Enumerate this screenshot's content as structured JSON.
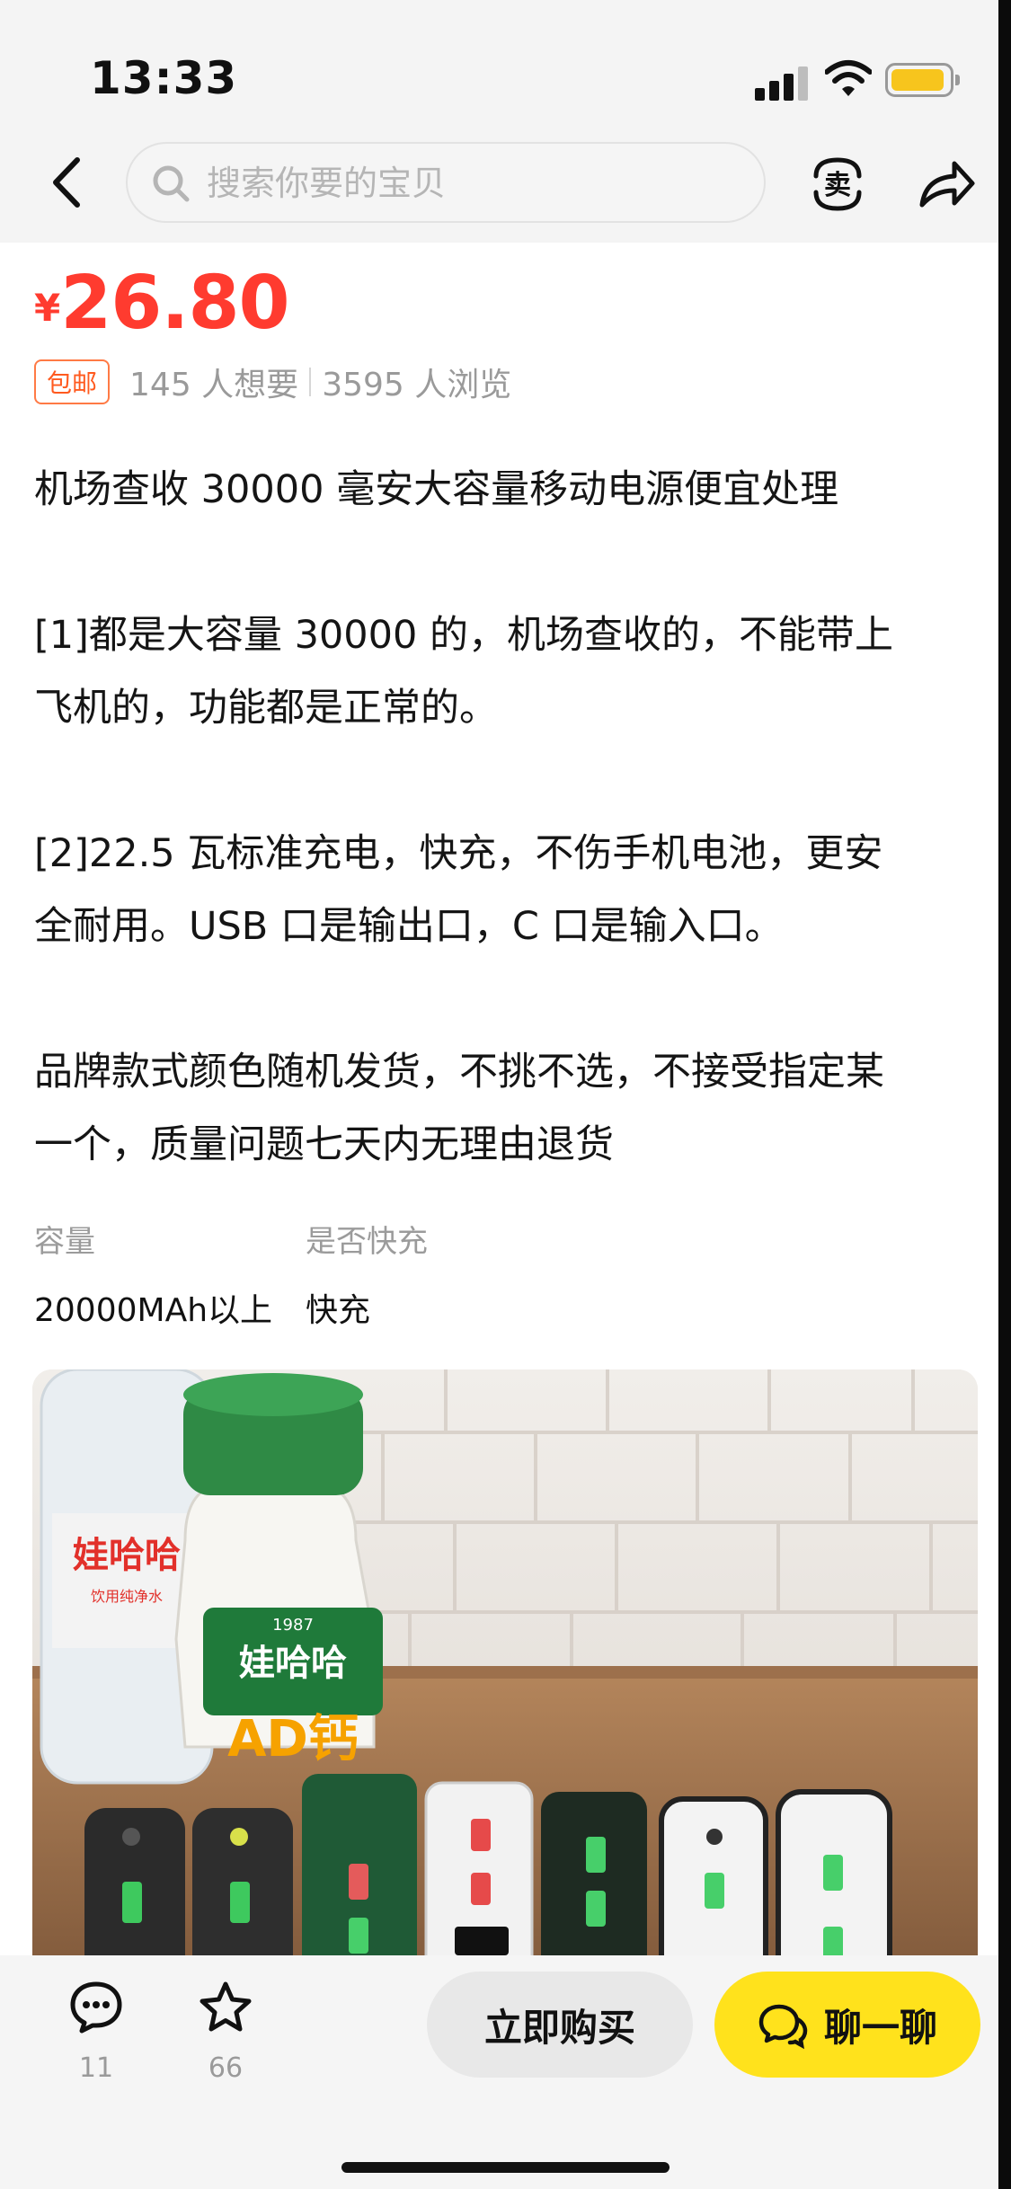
{
  "status_bar": {
    "time": "13:33"
  },
  "header": {
    "search_placeholder": "搜索你要的宝贝",
    "sell_icon_label": "卖"
  },
  "product": {
    "currency": "¥",
    "price": "26.80",
    "badge": "包邮",
    "wants": "145 人想要",
    "views": "3595 人浏览",
    "description": [
      "机场查收 30000 毫安大容量移动电源便宜处理",
      "",
      "[1]都是大容量 30000 的，机场查收的，不能带上",
      "飞机的，功能都是正常的。",
      "",
      "[2]22.5 瓦标准充电，快充，不伤手机电池，更安",
      "全耐用。USB 口是输出口，C 口是输入口。",
      "",
      "品牌款式颜色随机发货，不挑不选，不接受指定某",
      "一个，质量问题七天内无理由退货"
    ],
    "attributes": [
      {
        "key": "容量",
        "value": "20000MAh以上"
      },
      {
        "key": "是否快充",
        "value": "快充"
      }
    ],
    "photo": {
      "bottle_brand": "娃哈哈",
      "bottle_year": "1987",
      "bottle_sublabel": "饮用纯净水",
      "bottle_ad_text": "AD钙"
    }
  },
  "bottom_bar": {
    "comment_count": "11",
    "favorite_count": "66",
    "buy_label": "立即购买",
    "chat_label": "聊一聊"
  },
  "colors": {
    "price_red": "#ff3b2f",
    "accent_yellow": "#ffe21c",
    "badge_orange": "#ff7a45"
  }
}
